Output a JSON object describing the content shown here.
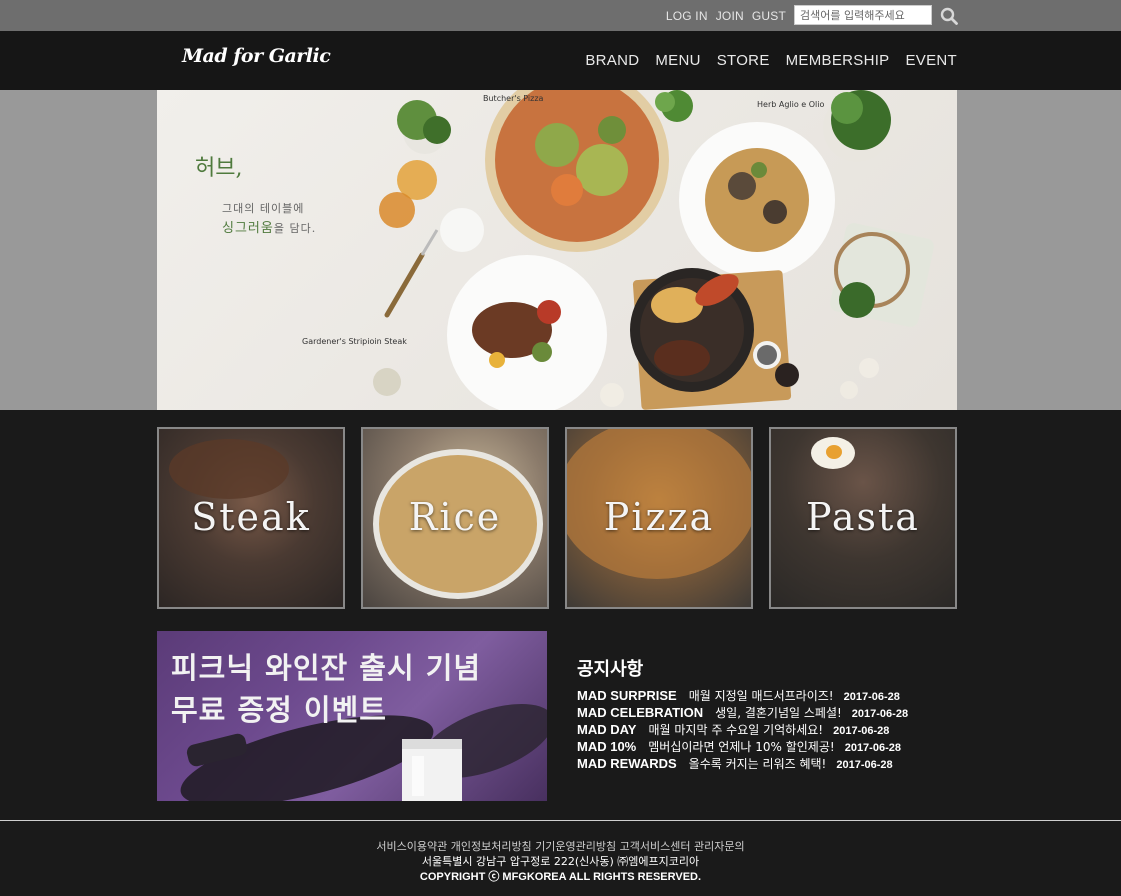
{
  "util": {
    "links": [
      "LOG IN",
      "JOIN",
      "GUST"
    ],
    "search_placeholder": "검색어를 입력해주세요"
  },
  "header": {
    "logo": "Mad for Garlic",
    "nav": [
      "BRAND",
      "MENU",
      "STORE",
      "MEMBERSHIP",
      "EVENT"
    ]
  },
  "hero": {
    "title": "허브,",
    "line1": "그대의 테이블에",
    "line2_em": "싱그러움",
    "line2_rest": "을 담다.",
    "captions": [
      "Butcher's Pizza",
      "Herb Aglio e Olio",
      "Gardener's Stripioin Steak"
    ]
  },
  "tiles": [
    "Steak",
    "Rice",
    "Pizza",
    "Pasta"
  ],
  "promo": {
    "line1": "피크닉 와인잔 출시 기념",
    "line2": "무료 증정 이벤트"
  },
  "notice": {
    "title": "공지사항",
    "items": [
      {
        "key": "MAD SURPRISE",
        "desc": "매월 지정일 매드서프라이즈!",
        "date": "2017-06-28"
      },
      {
        "key": "MAD CELEBRATION",
        "desc": "생일, 결혼기념일 스페셜!",
        "date": "2017-06-28"
      },
      {
        "key": "MAD DAY",
        "desc": "매월 마지막 주 수요일 기억하세요!",
        "date": "2017-06-28"
      },
      {
        "key": "MAD 10%",
        "desc": "멤버십이라면 언제나 10% 할인제공!",
        "date": "2017-06-28"
      },
      {
        "key": "MAD REWARDS",
        "desc": "올수록 커지는 리워즈 혜택!",
        "date": "2017-06-28"
      }
    ]
  },
  "footer": {
    "links": [
      "서비스이용약관",
      "개인정보처리방침",
      "기기운영관리방침",
      "고객서비스센터",
      "관리자문의"
    ],
    "address": "서울특별시 강남구 압구정로 222(신사동) ㈜엠에프지코리아",
    "copyright": "COPYRIGHT ⓒ MFGKOREA ALL RIGHTS RESERVED."
  }
}
